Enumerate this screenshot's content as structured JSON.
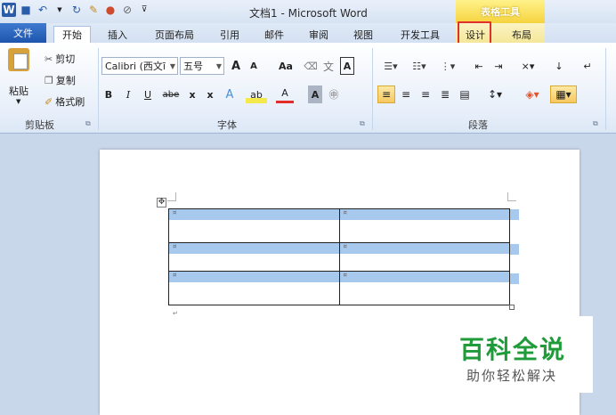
{
  "titlebar": {
    "app_logo": "W",
    "title": "文档1 - Microsoft Word",
    "context_tab_group": "表格工具",
    "qat_icons": [
      "word-logo-icon",
      "save-icon",
      "undo-icon",
      "redo-icon",
      "format-painter-icon",
      "color-icon",
      "draw-icon",
      "qat-dropdown-icon"
    ]
  },
  "tabs": {
    "file": "文件",
    "home": "开始",
    "insert": "插入",
    "page_layout": "页面布局",
    "references": "引用",
    "mailings": "邮件",
    "review": "审阅",
    "view": "视图",
    "developer": "开发工具",
    "design": "设计",
    "layout": "布局"
  },
  "ribbon": {
    "clipboard": {
      "label": "剪贴板",
      "paste": "粘贴",
      "cut": "剪切",
      "copy": "复制",
      "format_painter": "格式刷"
    },
    "font": {
      "label": "字体",
      "font_name": "Calibri (西文ī",
      "font_size": "五号",
      "grow": "A",
      "shrink": "A",
      "change_case": "Aa",
      "bold": "B",
      "italic": "I",
      "underline": "U",
      "strike": "abe",
      "subscript": "x",
      "superscript": "x",
      "text_effect": "A",
      "highlight": "ab",
      "font_color": "A",
      "char_shading": "A"
    },
    "paragraph": {
      "label": "段落"
    }
  },
  "colors": {
    "accent_file": "#1d55ad",
    "context_tab": "#f5d33f",
    "highlight_box": "#e0302b",
    "selection": "#a7c9ee",
    "watermark_green": "#1f9b3a"
  },
  "watermark": {
    "title": "百科全说",
    "subtitle": "助你轻松解决"
  }
}
